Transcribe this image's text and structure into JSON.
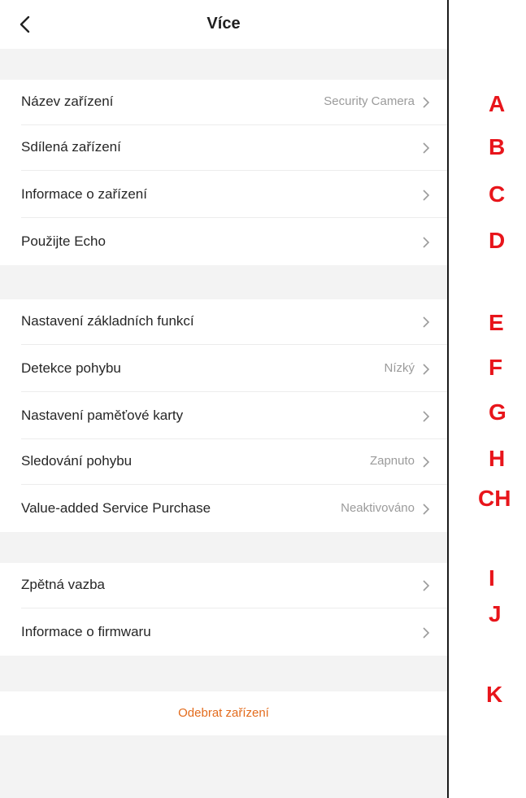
{
  "header": {
    "title": "Více",
    "back_icon": "chevron-left-icon"
  },
  "groups": [
    [
      {
        "label": "Název zařízení",
        "value": "Security Camera"
      },
      {
        "label": "Sdílená zařízení",
        "value": ""
      },
      {
        "label": "Informace o zařízení",
        "value": ""
      },
      {
        "label": "Použijte Echo",
        "value": ""
      }
    ],
    [
      {
        "label": "Nastavení základních funkcí",
        "value": ""
      },
      {
        "label": "Detekce pohybu",
        "value": "Nízký"
      },
      {
        "label": "Nastavení paměťové karty",
        "value": ""
      },
      {
        "label": "Sledování pohybu",
        "value": "Zapnuto"
      },
      {
        "label": "Value-added Service Purchase",
        "value": "Neaktivováno"
      }
    ],
    [
      {
        "label": "Zpětná vazba",
        "value": ""
      },
      {
        "label": "Informace o firmwaru",
        "value": ""
      }
    ]
  ],
  "remove_label": "Odebrat zařízení",
  "markers": [
    "A",
    "B",
    "C",
    "D",
    "E",
    "F",
    "G",
    "H",
    "CH",
    "I",
    "J",
    "K"
  ],
  "colors": {
    "accent": "#e36b1c",
    "marker": "#e8151b",
    "divider": "#f3f3f3"
  }
}
